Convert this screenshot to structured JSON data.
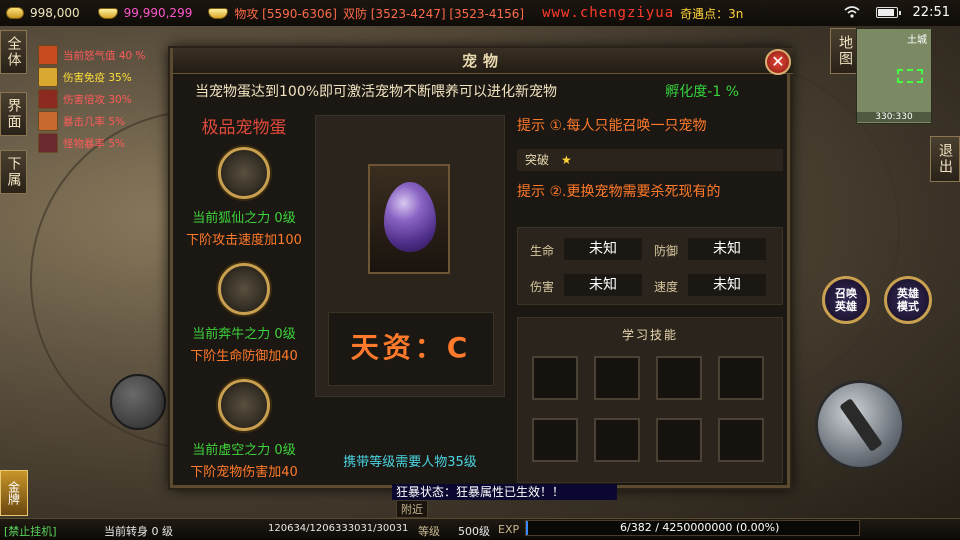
{
  "topbar": {
    "gold": "998,000",
    "yuanbao": "99,990,299",
    "attack": "物攻 [5590-6306]",
    "defense": "双防 [3523-4247] [3523-4156]",
    "url": "www.chengziyua",
    "location": "奇遇点：3n",
    "time": "22:51"
  },
  "left_tabs": [
    "全体",
    "界面",
    "下属"
  ],
  "right_tabs": [
    "地图",
    "退出"
  ],
  "buffs": [
    {
      "label": "当前怒气值 40 %",
      "icon": "rage-icon",
      "color": "#c84a20"
    },
    {
      "label": "伤害免疫 35%",
      "icon": "shield-buff-icon",
      "color": "#d8a830"
    },
    {
      "label": "伤害倍攻 30%",
      "icon": "attack-buff-icon",
      "color": "#8a2a20"
    },
    {
      "label": "暴击几率 5%",
      "icon": "crit-buff-icon",
      "color": "#c86a30"
    },
    {
      "label": "怪物暴率 5%",
      "icon": "drop-buff-icon",
      "color": "#6a2a30"
    }
  ],
  "minimap": {
    "name": "土城",
    "coord": "330:330"
  },
  "dialog": {
    "title": "宠物",
    "close": "✕",
    "notice": "当宠物蛋达到100%即可激活宠物不断喂养可以进化新宠物",
    "hatch": "孵化度-1 %",
    "left_title": "极品宠物蛋",
    "pets": [
      {
        "level": "当前狐仙之力 0级",
        "next": "下阶攻击速度加100",
        "icon": "wolf-portrait-icon"
      },
      {
        "level": "当前奔牛之力 0级",
        "next": "下阶生命防御加40",
        "icon": "bull-portrait-icon"
      },
      {
        "level": "当前虚空之力 0级",
        "next": "下阶宠物伤害加40",
        "icon": "void-portrait-icon"
      }
    ],
    "talent": "天资：C",
    "carry": "携带等级需要人物35级",
    "tip1": "提示 ①.每人只能召唤一只宠物",
    "break_label": "突破",
    "tip2": "提示 ②.更换宠物需要杀死现有的",
    "stats": [
      {
        "label": "生命",
        "value": "未知"
      },
      {
        "label": "防御",
        "value": "未知"
      },
      {
        "label": "伤害",
        "value": "未知"
      },
      {
        "label": "速度",
        "value": "未知"
      }
    ],
    "skills_title": "学习技能"
  },
  "right_buttons": [
    {
      "label": "召唤\n英雄"
    },
    {
      "label": "英雄\n模式"
    }
  ],
  "status_msg": "狂暴状态：狂暴属性已生效！！",
  "bottom": {
    "autoplay": "[禁止挂机]",
    "rebirth": "当前转身 0 级",
    "hp": "120634/1206333031/30031",
    "nearby": "附近",
    "level_label": "等级",
    "level": "500级",
    "exp_label": "EXP",
    "exp": "6/382 / 4250000000 (0.00%)"
  },
  "left_extra": "金牌"
}
